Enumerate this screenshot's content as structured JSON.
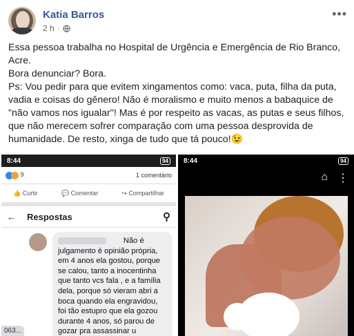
{
  "post": {
    "author": "Katia Barros",
    "time": "2 h",
    "menu_icon": "more-horizontal-icon",
    "privacy_icon": "globe-icon",
    "text": "Essa pessoa trabalha no Hospital de Urgência e Emergência de Rio Branco,\nAcre.\nBora denunciar? Bora.\nPs: Vou pedir para que evitem xingamentos como: vaca, puta, filha da puta,\nvadia e coisas do gênero! Não é moralismo e muito menos a babaquice de\n\"não vamos nos igualar\"! Mas é por respeito as vacas, as putas e seus filhos,\nque não merecem sofrer comparação com uma pessoa desprovida de\nhumanidade. De resto, xinga de tudo que tá pouco!😉"
  },
  "screenshot1": {
    "status_time": "8:44",
    "battery": "94",
    "reaction_count": "9",
    "comment_count": "1 comentário",
    "actions": [
      "Curtir",
      "Comentar",
      "Compartilhar"
    ],
    "responses_title": "Respostas",
    "comment_text": "Não é\njulgamento é opinião própria,\nem 4 anos ela gostou, porque\nse calou, tanto a inocentinha\nque tanto vcs fala , e a família\ndela, porque só vieram abri a\nboca quando ela engravidou,\nfoi tão estupro que ela gozou\ndurante 4 anos, só parou de\ngozar pra assassinar u",
    "corner_text": "063..."
  },
  "screenshot2": {
    "status_time": "8:44",
    "battery": "94",
    "icons": [
      "tag-icon",
      "more-vertical-icon"
    ]
  }
}
